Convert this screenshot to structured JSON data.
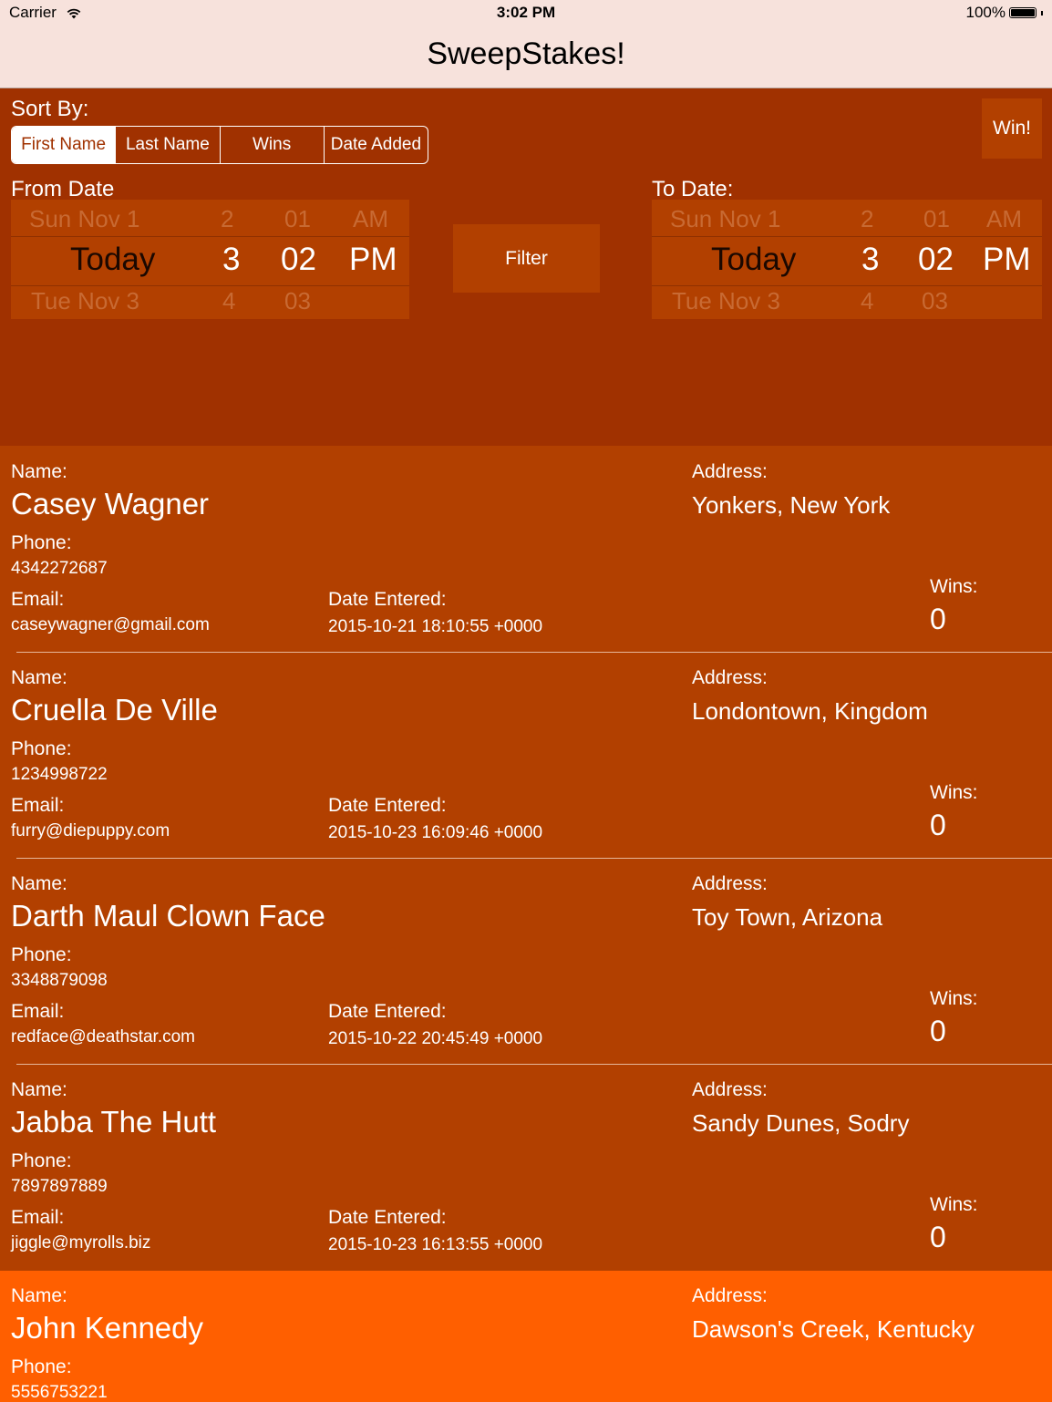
{
  "status_bar": {
    "carrier": "Carrier",
    "time": "3:02 PM",
    "battery": "100%"
  },
  "nav": {
    "title": "SweepStakes!"
  },
  "controls": {
    "sort_label": "Sort By:",
    "sort_options": [
      "First Name",
      "Last Name",
      "Wins",
      "Date Added"
    ],
    "selected_sort": "First Name",
    "win_button": "Win!",
    "filter_button": "Filter",
    "from_label": "From Date",
    "to_label": "To Date:",
    "from_picker": {
      "above": [
        "Sun Nov 1",
        "2",
        "01",
        "AM"
      ],
      "selected": [
        "Today",
        "3",
        "02",
        "PM"
      ],
      "below": [
        "Tue Nov 3",
        "4",
        "03",
        ""
      ]
    },
    "to_picker": {
      "above": [
        "Sun Nov 1",
        "2",
        "01",
        "AM"
      ],
      "selected": [
        "Today",
        "3",
        "02",
        "PM"
      ],
      "below": [
        "Tue Nov 3",
        "4",
        "03",
        ""
      ]
    }
  },
  "labels": {
    "name": "Name:",
    "phone": "Phone:",
    "email": "Email:",
    "date_entered": "Date Entered:",
    "address": "Address:",
    "wins": "Wins:"
  },
  "entries": [
    {
      "name": "Casey Wagner",
      "phone": "4342272687",
      "email": "caseywagner@gmail.com",
      "date_entered": "2015-10-21 18:10:55 +0000",
      "address": "Yonkers, New York",
      "wins": "0"
    },
    {
      "name": "Cruella De Ville",
      "phone": "1234998722",
      "email": "furry@diepuppy.com",
      "date_entered": "2015-10-23 16:09:46 +0000",
      "address": "Londontown, Kingdom",
      "wins": "0"
    },
    {
      "name": "Darth Maul Clown Face",
      "phone": "3348879098",
      "email": "redface@deathstar.com",
      "date_entered": "2015-10-22 20:45:49 +0000",
      "address": "Toy Town, Arizona",
      "wins": "0"
    },
    {
      "name": "Jabba The Hutt",
      "phone": "7897897889",
      "email": "jiggle@myrolls.biz",
      "date_entered": "2015-10-23 16:13:55 +0000",
      "address": "Sandy Dunes, Sodry",
      "wins": "0"
    },
    {
      "name": "John Kennedy",
      "phone": "5556753221",
      "address": "Dawson's Creek, Kentucky"
    }
  ],
  "colors": {
    "nav_bg": "#f7e2dc",
    "controls_bg": "#a03100",
    "row_bg": "#b24000",
    "highlight_row_bg": "#ff5f00"
  },
  "icons": [
    "wifi-icon",
    "battery-icon"
  ]
}
